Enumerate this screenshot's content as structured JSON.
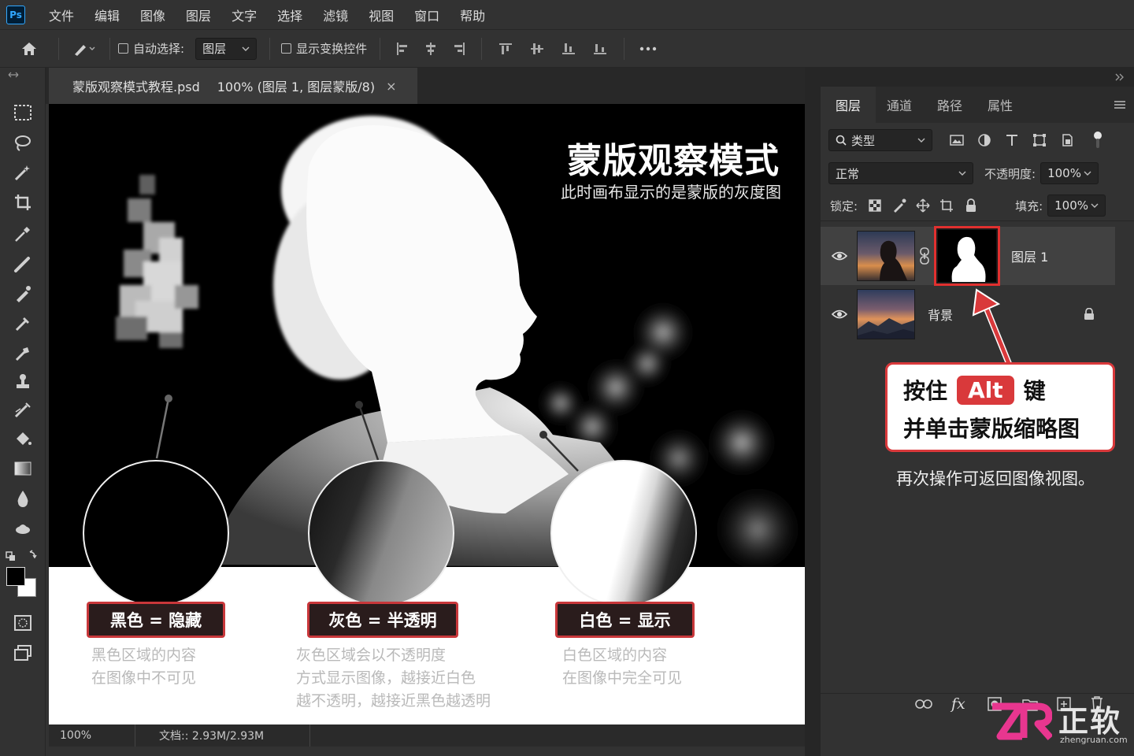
{
  "app": {
    "logo": "Ps"
  },
  "menu": [
    "文件",
    "编辑",
    "图像",
    "图层",
    "文字",
    "选择",
    "滤镜",
    "视图",
    "窗口",
    "帮助"
  ],
  "options": {
    "auto_select_label": "自动选择:",
    "auto_select_value": "图层",
    "show_transform_label": "显示变换控件"
  },
  "document": {
    "tab_title": "蒙版观察模式教程.psd",
    "tab_detail": "100% (图层 1, 图层蒙版/8)",
    "close": "×",
    "zoom": "100%",
    "doc_size": "文档:: 2.93M/2.93M"
  },
  "canvas": {
    "title": "蒙版观察模式",
    "subtitle": "此时画布显示的是蒙版的灰度图",
    "panels": [
      {
        "badge": "黑色 = 隐藏",
        "desc": [
          "黑色区域的内容",
          "在图像中不可见"
        ]
      },
      {
        "badge": "灰色 = 半透明",
        "desc": [
          "灰色区域会以不透明度",
          "方式显示图像，越接近白色",
          "越不透明，越接近黑色越透明"
        ]
      },
      {
        "badge": "白色 = 显示",
        "desc": [
          "白色区域的内容",
          "在图像中完全可见"
        ]
      }
    ]
  },
  "layers_panel": {
    "tabs": [
      "图层",
      "通道",
      "路径",
      "属性"
    ],
    "filter_kind": "类型",
    "blend_mode": "正常",
    "opacity_label": "不透明度:",
    "opacity_value": "100%",
    "lock_label": "锁定:",
    "fill_label": "填充:",
    "fill_value": "100%",
    "layers": [
      {
        "name": "图层 1",
        "has_mask": true,
        "visible": true,
        "selected": true
      },
      {
        "name": "背景",
        "locked": true,
        "visible": true,
        "selected": false
      }
    ]
  },
  "callout": {
    "line1_pre": "按住",
    "key": "Alt",
    "line1_post": "键",
    "line2": "并单击蒙版缩略图",
    "note": "再次操作可返回图像视图。"
  },
  "watermark": {
    "brand": "正软",
    "url": "zhengruan.com"
  },
  "colors": {
    "accent_red": "#d9393b",
    "ps_blue": "#31a8ff",
    "panel_bg": "#323232"
  }
}
